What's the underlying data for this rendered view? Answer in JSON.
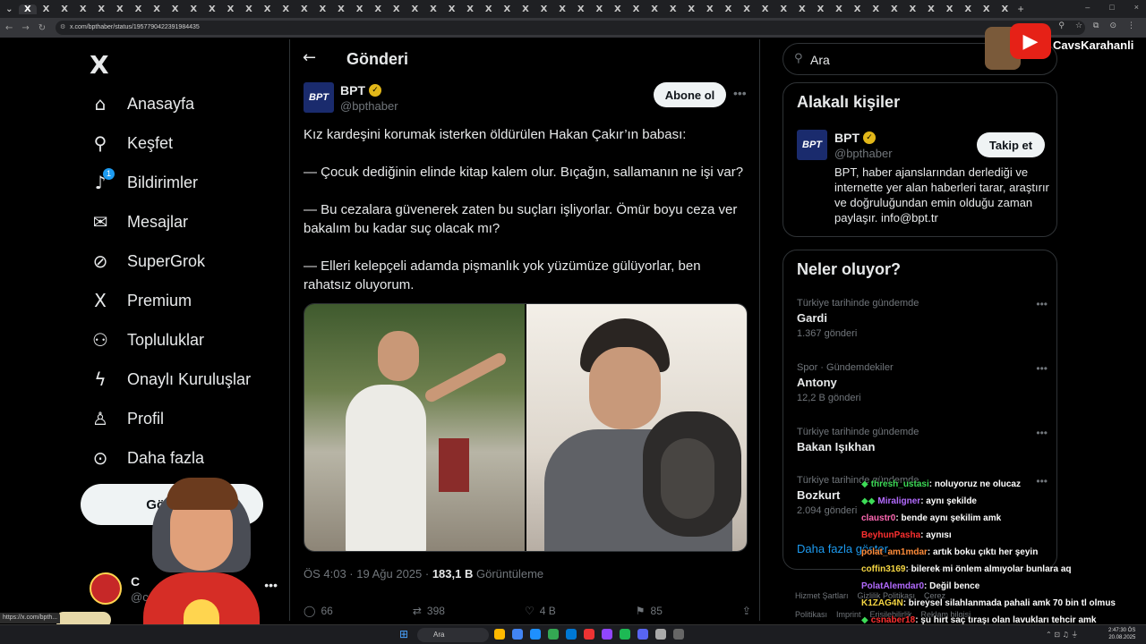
{
  "browser": {
    "tab_close_glyph": "X",
    "new_tab": "+",
    "url": "x.com/bpthaber/status/1957790422391984435",
    "window_controls": [
      "–",
      "□",
      "×"
    ],
    "status_url": "https://x.com/bpth..."
  },
  "nav": {
    "logo": "X",
    "items": [
      {
        "label": "Anasayfa",
        "icon": "home-icon",
        "glyph": "⌂"
      },
      {
        "label": "Keşfet",
        "icon": "search-icon",
        "glyph": "⚲"
      },
      {
        "label": "Bildirimler",
        "icon": "bell-icon",
        "glyph": "♪",
        "badge": "1"
      },
      {
        "label": "Mesajlar",
        "icon": "mail-icon",
        "glyph": "✉"
      },
      {
        "label": "SuperGrok",
        "icon": "grok-icon",
        "glyph": "⊘"
      },
      {
        "label": "Premium",
        "icon": "x-premium-icon",
        "glyph": "X"
      },
      {
        "label": "Topluluklar",
        "icon": "communities-icon",
        "glyph": "⚇"
      },
      {
        "label": "Onaylı Kuruluşlar",
        "icon": "lightning-icon",
        "glyph": "ϟ"
      },
      {
        "label": "Profil",
        "icon": "profile-icon",
        "glyph": "♙"
      },
      {
        "label": "Daha fazla",
        "icon": "more-circle-icon",
        "glyph": "⊙"
      }
    ],
    "post_button": "Gönderi",
    "account": {
      "name": "C",
      "handle": "@c",
      "more": "•••"
    }
  },
  "main": {
    "title": "Gönderi",
    "back_glyph": "←",
    "tweet": {
      "avatar_text": "BPT",
      "name": "BPT",
      "handle": "@bpthaber",
      "follow_label": "Abone ol",
      "more": "•••",
      "paragraphs": [
        "Kız kardeşini korumak isterken öldürülen Hakan Çakır’ın babası:",
        "— Çocuk dediğinin elinde kitap kalem olur. Bıçağın, sallamanın ne işi var?",
        "— Bu cezalara güvenerek zaten bu suçları işliyorlar. Ömür boyu ceza ver bakalım bu kadar suç olacak mı?",
        "— Elleri kelepçeli adamda pişmanlık yok yüzümüze gülüyorlar, ben rahatsız oluyorum."
      ],
      "time": "ÖS 4:03 · 19 Ağu 2025 · ",
      "views_count": "183,1 B",
      "views_label": " Görüntüleme",
      "actions": [
        {
          "icon": "reply-icon",
          "glyph": "◯",
          "count": "66"
        },
        {
          "icon": "retweet-icon",
          "glyph": "⇄",
          "count": "398"
        },
        {
          "icon": "like-icon",
          "glyph": "♡",
          "count": "4 B"
        },
        {
          "icon": "bookmark-icon",
          "glyph": "⚑",
          "count": "85"
        },
        {
          "icon": "share-icon",
          "glyph": "⇪",
          "count": ""
        }
      ]
    }
  },
  "right": {
    "search_placeholder": "Ara",
    "related": {
      "title": "Alakalı kişiler",
      "avatar_text": "BPT",
      "name": "BPT",
      "handle": "@bpthaber",
      "follow_label": "Takip et",
      "bio": "BPT, haber ajanslarından derlediği ve internette yer alan haberleri tarar, araştırır ve doğruluğundan emin olduğu zaman paylaşır. info@bpt.tr"
    },
    "trends": {
      "title": "Neler oluyor?",
      "items": [
        {
          "context": "Türkiye tarihinde gündemde",
          "topic": "Gardi",
          "count": "1.367 gönderi"
        },
        {
          "context": "Spor · Gündemdekiler",
          "topic": "Antony",
          "count": "12,2 B gönderi"
        },
        {
          "context": "Türkiye tarihinde gündemde",
          "topic": "Bakan Işıkhan",
          "count": ""
        },
        {
          "context": "Türkiye tarihinde gündemde",
          "topic": "Bozkurt",
          "count": "2.094 gönderi"
        }
      ],
      "show_more": "Daha fazla göster"
    },
    "footer": [
      "Hizmet Şartları",
      "Gizlilik Politikası",
      "Çerez Politikası",
      "Imprint",
      "Erişilebilirlik",
      "Reklam bilgisi"
    ]
  },
  "overlay": {
    "channel": "CavsKarahanli",
    "chat": [
      {
        "user": "thresh_ustasi",
        "color": "#3ddc57",
        "msg": ": noluyoruz ne olucaz",
        "badge": "◆"
      },
      {
        "user": "Miraligner",
        "color": "#b36bff",
        "msg": ": aynı şekilde",
        "badge": "◆◆"
      },
      {
        "user": "claustr0",
        "color": "#ff69b4",
        "msg": ": bende aynı şekilim amk",
        "badge": ""
      },
      {
        "user": "BeyhunPasha",
        "color": "#ff3030",
        "msg": ": aynısı",
        "badge": ""
      },
      {
        "user": "polat_am1mdar",
        "color": "#ff8c3a",
        "msg": ": artık boku çıktı her şeyin",
        "badge": ""
      },
      {
        "user": "coffin3169",
        "color": "#f6d743",
        "msg": ": bilerek mi önlem almıyolar bunlara aq",
        "badge": ""
      },
      {
        "user": "PolatAlemdar0",
        "color": "#b36bff",
        "msg": ": Değil bence",
        "badge": ""
      },
      {
        "user": "K1ZAG4N",
        "color": "#f6d743",
        "msg": ": bireysel silahlanmada pahali amk 70 bin tl olmus",
        "badge": ""
      },
      {
        "user": "csnaber18",
        "color": "#ff3030",
        "msg": ": şu hırt saç tıraşı olan lavukları tehcir amk",
        "badge": "◆"
      }
    ]
  },
  "taskbar": {
    "search": "Ara",
    "time": "2:47:30 ÖS",
    "date": "20.08.2025",
    "app_colors": [
      "#ffb900",
      "#4285f4",
      "#1e90ff",
      "#34a853",
      "#0078d4",
      "#e33",
      "#9146ff",
      "#1db954",
      "#5865f2",
      "#aaa",
      "#666"
    ]
  }
}
